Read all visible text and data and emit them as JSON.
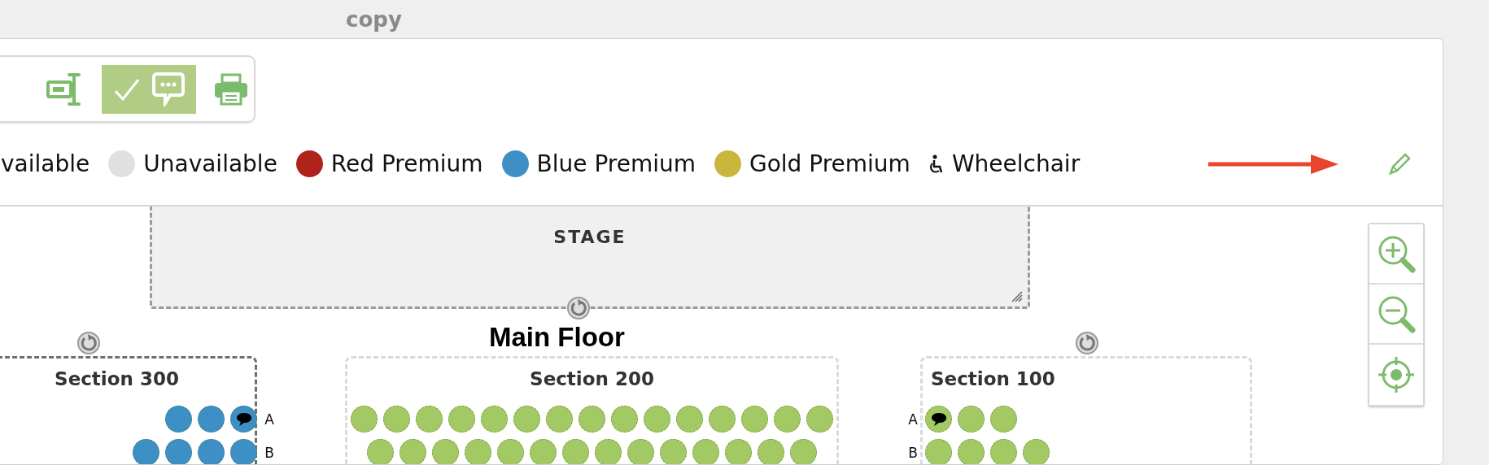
{
  "header": {
    "title": "copy"
  },
  "toolbar": [
    {
      "kind": "align",
      "selected": false
    },
    {
      "kind": "comments",
      "selected": true
    },
    {
      "kind": "print",
      "selected": false
    }
  ],
  "legend": [
    {
      "label": "vailable",
      "kind": "text"
    },
    {
      "label": "Unavailable",
      "kind": "dot",
      "color": "#e0e0e0"
    },
    {
      "label": "Red Premium",
      "kind": "dot",
      "color": "#b0231a"
    },
    {
      "label": "Blue Premium",
      "kind": "dot",
      "color": "#3d8fc6"
    },
    {
      "label": "Gold Premium",
      "kind": "dot",
      "color": "#c9b63d"
    },
    {
      "label": "Wheelchair",
      "kind": "wheelchair"
    }
  ],
  "stage": {
    "label": "STAGE"
  },
  "floor": {
    "title": "Main Floor"
  },
  "sections": [
    {
      "title": "Section 300",
      "kind": "right",
      "active": true,
      "rows": [
        {
          "label": "A",
          "seats": [
            {
              "color": "#3d8fc6",
              "comment": false
            },
            {
              "color": "#3d8fc6",
              "comment": false
            },
            {
              "color": "#3d8fc6",
              "comment": true
            }
          ]
        },
        {
          "label": "B",
          "seats": [
            {
              "color": "#3d8fc6",
              "comment": false
            },
            {
              "color": "#3d8fc6",
              "comment": false
            },
            {
              "color": "#3d8fc6",
              "comment": false
            },
            {
              "color": "#3d8fc6",
              "comment": false
            }
          ]
        }
      ]
    },
    {
      "title": "Section 200",
      "kind": "center",
      "active": false,
      "rows": [
        {
          "seats": [
            {
              "color": "#a3c964",
              "comment": false
            },
            {
              "color": "#a3c964",
              "comment": false
            },
            {
              "color": "#a3c964",
              "comment": false
            },
            {
              "color": "#a3c964",
              "comment": false
            },
            {
              "color": "#a3c964",
              "comment": false
            },
            {
              "color": "#a3c964",
              "comment": false
            },
            {
              "color": "#a3c964",
              "comment": false
            },
            {
              "color": "#a3c964",
              "comment": false
            },
            {
              "color": "#a3c964",
              "comment": false
            },
            {
              "color": "#a3c964",
              "comment": false
            },
            {
              "color": "#a3c964",
              "comment": false
            },
            {
              "color": "#a3c964",
              "comment": false
            },
            {
              "color": "#a3c964",
              "comment": false
            },
            {
              "color": "#a3c964",
              "comment": false
            },
            {
              "color": "#a3c964",
              "comment": false
            }
          ]
        },
        {
          "seats": [
            {
              "color": "#a3c964",
              "comment": false
            },
            {
              "color": "#a3c964",
              "comment": false
            },
            {
              "color": "#a3c964",
              "comment": false
            },
            {
              "color": "#a3c964",
              "comment": false
            },
            {
              "color": "#a3c964",
              "comment": false
            },
            {
              "color": "#a3c964",
              "comment": false
            },
            {
              "color": "#a3c964",
              "comment": false
            },
            {
              "color": "#a3c964",
              "comment": false
            },
            {
              "color": "#a3c964",
              "comment": false
            },
            {
              "color": "#a3c964",
              "comment": false
            },
            {
              "color": "#a3c964",
              "comment": false
            },
            {
              "color": "#a3c964",
              "comment": false
            },
            {
              "color": "#a3c964",
              "comment": false
            },
            {
              "color": "#a3c964",
              "comment": false
            }
          ]
        }
      ]
    },
    {
      "title": "Section 100",
      "kind": "left",
      "active": false,
      "rows": [
        {
          "label": "A",
          "seats": [
            {
              "color": "#a3c964",
              "comment": true
            },
            {
              "color": "#a3c964",
              "comment": false
            },
            {
              "color": "#a3c964",
              "comment": false
            }
          ]
        },
        {
          "label": "B",
          "seats": [
            {
              "color": "#a3c964",
              "comment": false
            },
            {
              "color": "#a3c964",
              "comment": false
            },
            {
              "color": "#a3c964",
              "comment": false
            },
            {
              "color": "#a3c964",
              "comment": false
            }
          ]
        }
      ]
    }
  ],
  "zoom_controls": [
    {
      "kind": "zoom_in"
    },
    {
      "kind": "zoom_out"
    },
    {
      "kind": "center"
    }
  ]
}
